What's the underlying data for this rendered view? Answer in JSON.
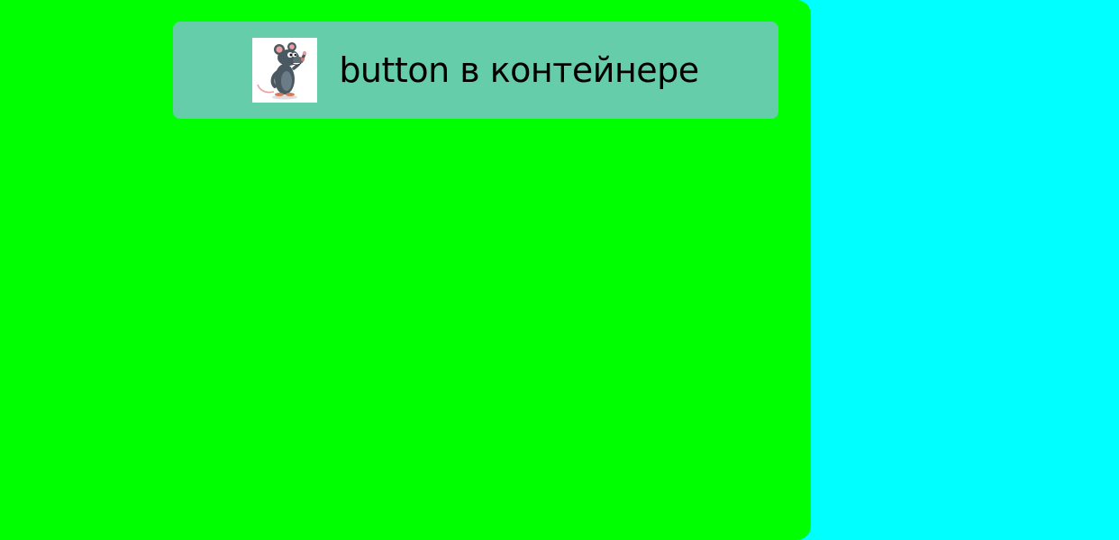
{
  "colors": {
    "page_background": "#00ffff",
    "container_background": "#00ff00",
    "button_background": "#66cdaa",
    "button_text": "#000000"
  },
  "button": {
    "label": "button в контейнере",
    "icon": "rat-cartoon-icon"
  }
}
